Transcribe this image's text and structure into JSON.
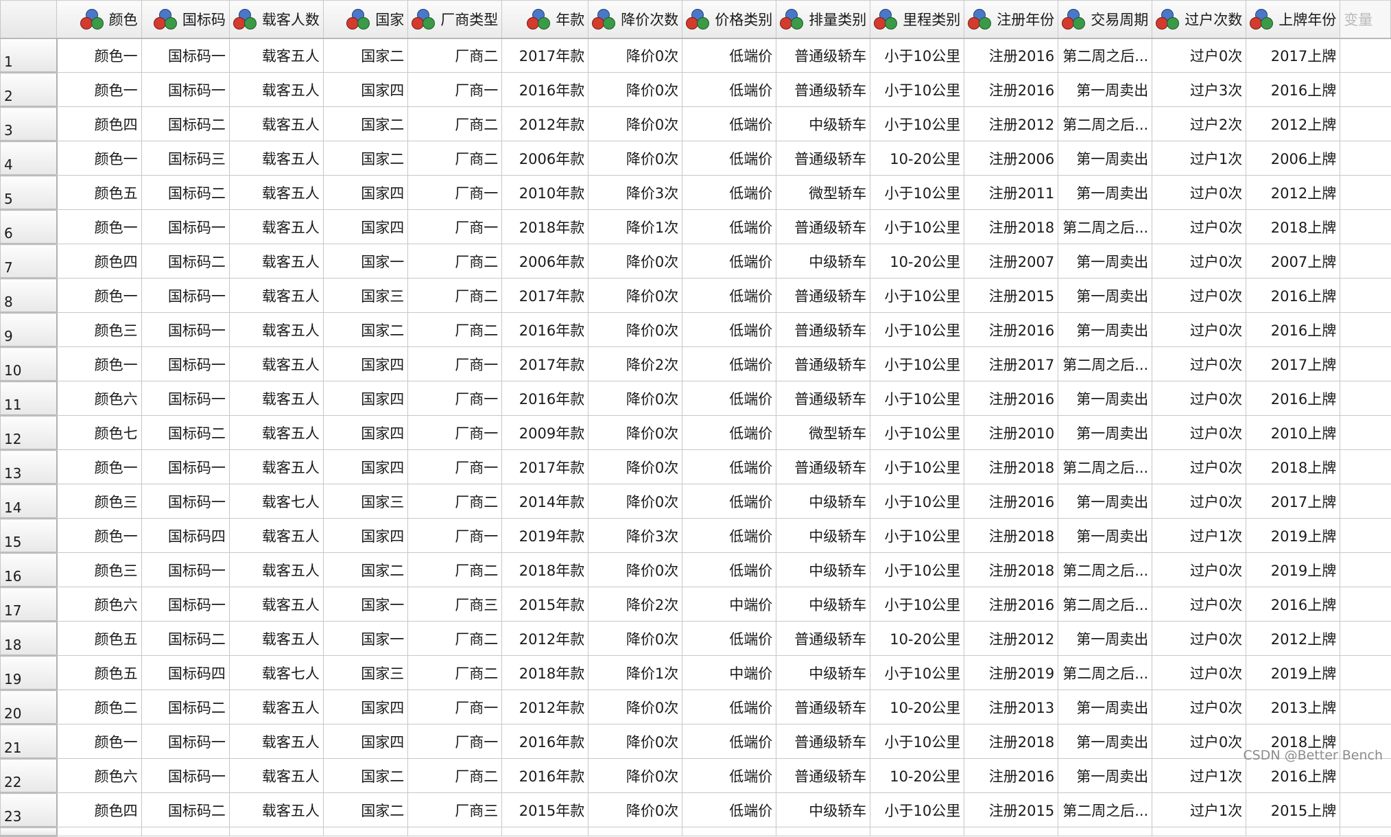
{
  "columns": [
    {
      "label": "颜色",
      "icon": "nominal-measure-icon"
    },
    {
      "label": "国标码",
      "icon": "nominal-measure-icon"
    },
    {
      "label": "载客人数",
      "icon": "nominal-measure-icon"
    },
    {
      "label": "国家",
      "icon": "nominal-measure-icon"
    },
    {
      "label": "厂商类型",
      "icon": "nominal-measure-icon"
    },
    {
      "label": "年款",
      "icon": "nominal-measure-icon"
    },
    {
      "label": "降价次数",
      "icon": "nominal-measure-icon"
    },
    {
      "label": "价格类别",
      "icon": "nominal-measure-icon"
    },
    {
      "label": "排量类别",
      "icon": "nominal-measure-icon"
    },
    {
      "label": "里程类别",
      "icon": "nominal-measure-icon"
    },
    {
      "label": "注册年份",
      "icon": "nominal-measure-icon"
    },
    {
      "label": "交易周期",
      "icon": "nominal-measure-icon"
    },
    {
      "label": "过户次数",
      "icon": "nominal-measure-icon"
    },
    {
      "label": "上牌年份",
      "icon": "nominal-measure-icon"
    }
  ],
  "extra_column_label": "变量",
  "rows": [
    [
      "1",
      "颜色一",
      "国标码一",
      "载客五人",
      "国家二",
      "厂商二",
      "2017年款",
      "降价0次",
      "低端价",
      "普通级轿车",
      "小于10公里",
      "注册2016",
      "第二周之后...",
      "过户0次",
      "2017上牌"
    ],
    [
      "2",
      "颜色一",
      "国标码一",
      "载客五人",
      "国家四",
      "厂商一",
      "2016年款",
      "降价0次",
      "低端价",
      "普通级轿车",
      "小于10公里",
      "注册2016",
      "第一周卖出",
      "过户3次",
      "2016上牌"
    ],
    [
      "3",
      "颜色四",
      "国标码二",
      "载客五人",
      "国家二",
      "厂商二",
      "2012年款",
      "降价0次",
      "低端价",
      "中级轿车",
      "小于10公里",
      "注册2012",
      "第二周之后...",
      "过户2次",
      "2012上牌"
    ],
    [
      "4",
      "颜色一",
      "国标码三",
      "载客五人",
      "国家二",
      "厂商二",
      "2006年款",
      "降价0次",
      "低端价",
      "普通级轿车",
      "10-20公里",
      "注册2006",
      "第一周卖出",
      "过户1次",
      "2006上牌"
    ],
    [
      "5",
      "颜色五",
      "国标码二",
      "载客五人",
      "国家四",
      "厂商一",
      "2010年款",
      "降价3次",
      "低端价",
      "微型轿车",
      "小于10公里",
      "注册2011",
      "第一周卖出",
      "过户0次",
      "2012上牌"
    ],
    [
      "6",
      "颜色一",
      "国标码一",
      "载客五人",
      "国家四",
      "厂商一",
      "2018年款",
      "降价1次",
      "低端价",
      "普通级轿车",
      "小于10公里",
      "注册2018",
      "第二周之后...",
      "过户0次",
      "2018上牌"
    ],
    [
      "7",
      "颜色四",
      "国标码二",
      "载客五人",
      "国家一",
      "厂商二",
      "2006年款",
      "降价0次",
      "低端价",
      "中级轿车",
      "10-20公里",
      "注册2007",
      "第一周卖出",
      "过户0次",
      "2007上牌"
    ],
    [
      "8",
      "颜色一",
      "国标码一",
      "载客五人",
      "国家三",
      "厂商二",
      "2017年款",
      "降价0次",
      "低端价",
      "普通级轿车",
      "小于10公里",
      "注册2015",
      "第一周卖出",
      "过户0次",
      "2016上牌"
    ],
    [
      "9",
      "颜色三",
      "国标码一",
      "载客五人",
      "国家二",
      "厂商二",
      "2016年款",
      "降价0次",
      "低端价",
      "普通级轿车",
      "小于10公里",
      "注册2016",
      "第一周卖出",
      "过户0次",
      "2016上牌"
    ],
    [
      "10",
      "颜色一",
      "国标码一",
      "载客五人",
      "国家四",
      "厂商一",
      "2017年款",
      "降价2次",
      "低端价",
      "普通级轿车",
      "小于10公里",
      "注册2017",
      "第二周之后...",
      "过户0次",
      "2017上牌"
    ],
    [
      "11",
      "颜色六",
      "国标码一",
      "载客五人",
      "国家四",
      "厂商一",
      "2016年款",
      "降价0次",
      "低端价",
      "普通级轿车",
      "小于10公里",
      "注册2016",
      "第一周卖出",
      "过户0次",
      "2016上牌"
    ],
    [
      "12",
      "颜色七",
      "国标码二",
      "载客五人",
      "国家四",
      "厂商一",
      "2009年款",
      "降价0次",
      "低端价",
      "微型轿车",
      "小于10公里",
      "注册2010",
      "第一周卖出",
      "过户0次",
      "2010上牌"
    ],
    [
      "13",
      "颜色一",
      "国标码一",
      "载客五人",
      "国家四",
      "厂商一",
      "2017年款",
      "降价0次",
      "低端价",
      "普通级轿车",
      "小于10公里",
      "注册2018",
      "第二周之后...",
      "过户0次",
      "2018上牌"
    ],
    [
      "14",
      "颜色三",
      "国标码一",
      "载客七人",
      "国家三",
      "厂商二",
      "2014年款",
      "降价0次",
      "低端价",
      "中级轿车",
      "小于10公里",
      "注册2016",
      "第一周卖出",
      "过户0次",
      "2017上牌"
    ],
    [
      "15",
      "颜色一",
      "国标码四",
      "载客五人",
      "国家四",
      "厂商一",
      "2019年款",
      "降价3次",
      "低端价",
      "中级轿车",
      "小于10公里",
      "注册2018",
      "第一周卖出",
      "过户1次",
      "2019上牌"
    ],
    [
      "16",
      "颜色三",
      "国标码一",
      "载客五人",
      "国家二",
      "厂商二",
      "2018年款",
      "降价0次",
      "低端价",
      "中级轿车",
      "小于10公里",
      "注册2018",
      "第二周之后...",
      "过户0次",
      "2019上牌"
    ],
    [
      "17",
      "颜色六",
      "国标码一",
      "载客五人",
      "国家一",
      "厂商三",
      "2015年款",
      "降价2次",
      "中端价",
      "中级轿车",
      "小于10公里",
      "注册2016",
      "第二周之后...",
      "过户0次",
      "2016上牌"
    ],
    [
      "18",
      "颜色五",
      "国标码二",
      "载客五人",
      "国家一",
      "厂商二",
      "2012年款",
      "降价0次",
      "低端价",
      "普通级轿车",
      "10-20公里",
      "注册2012",
      "第一周卖出",
      "过户0次",
      "2012上牌"
    ],
    [
      "19",
      "颜色五",
      "国标码四",
      "载客七人",
      "国家三",
      "厂商二",
      "2018年款",
      "降价1次",
      "中端价",
      "中级轿车",
      "小于10公里",
      "注册2019",
      "第二周之后...",
      "过户0次",
      "2019上牌"
    ],
    [
      "20",
      "颜色二",
      "国标码二",
      "载客五人",
      "国家四",
      "厂商一",
      "2012年款",
      "降价0次",
      "低端价",
      "普通级轿车",
      "10-20公里",
      "注册2013",
      "第一周卖出",
      "过户0次",
      "2013上牌"
    ],
    [
      "21",
      "颜色一",
      "国标码一",
      "载客五人",
      "国家四",
      "厂商一",
      "2016年款",
      "降价0次",
      "低端价",
      "普通级轿车",
      "小于10公里",
      "注册2018",
      "第一周卖出",
      "过户0次",
      "2018上牌"
    ],
    [
      "22",
      "颜色六",
      "国标码一",
      "载客五人",
      "国家二",
      "厂商二",
      "2016年款",
      "降价0次",
      "低端价",
      "普通级轿车",
      "10-20公里",
      "注册2016",
      "第一周卖出",
      "过户1次",
      "2016上牌"
    ],
    [
      "23",
      "颜色四",
      "国标码二",
      "载客五人",
      "国家二",
      "厂商三",
      "2015年款",
      "降价0次",
      "低端价",
      "中级轿车",
      "小于10公里",
      "注册2015",
      "第二周之后...",
      "过户1次",
      "2015上牌"
    ]
  ],
  "watermark": "CSDN @Better Bench"
}
